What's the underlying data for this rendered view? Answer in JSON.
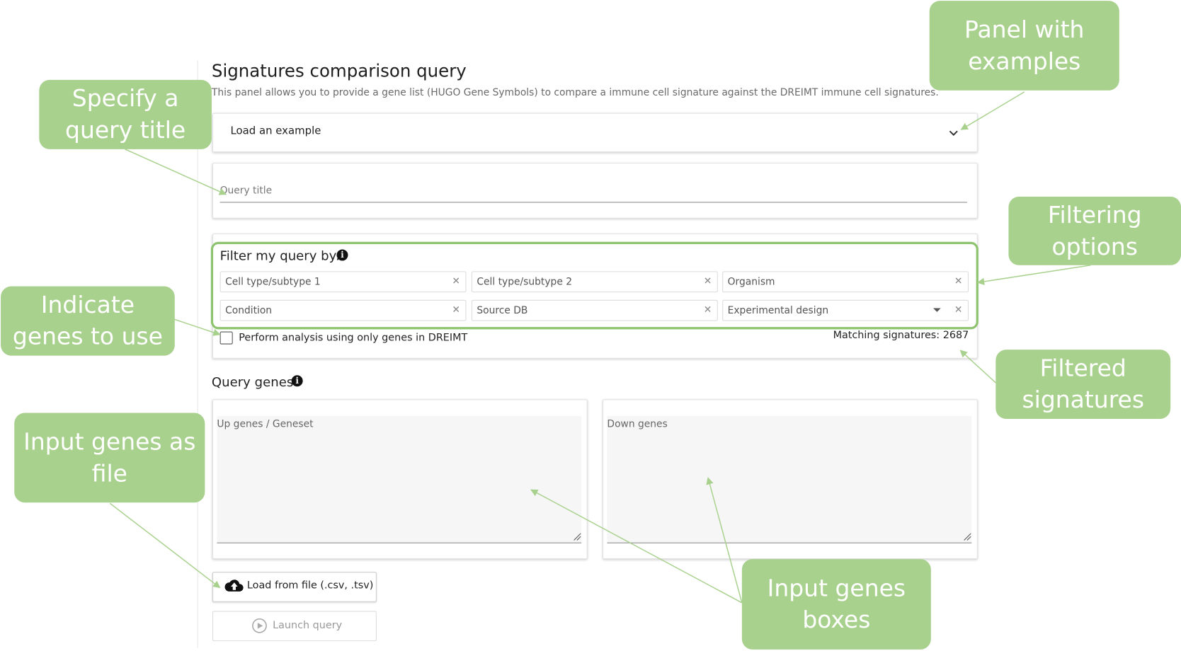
{
  "panel": {
    "title": "Signatures comparison query",
    "description": "This panel allows you to provide a gene list (HUGO Gene Symbols) to compare a immune cell signature against the DREIMT immune cell signatures."
  },
  "example": {
    "label": "Load an example"
  },
  "query_title": {
    "label": "Query title"
  },
  "filters": {
    "heading": "Filter my query by:",
    "fields": [
      "Cell type/subtype 1",
      "Cell type/subtype 2",
      "Organism",
      "Condition",
      "Source DB",
      "Experimental design"
    ],
    "checkbox_label": "Perform analysis using only genes in DREIMT",
    "matching_signatures": "Matching signatures: 2687"
  },
  "query_genes": {
    "heading": "Query genes",
    "up_label": "Up genes / Geneset",
    "down_label": "Down genes"
  },
  "buttons": {
    "load_file": "Load from file (.csv, .tsv)",
    "launch": "Launch query"
  },
  "callouts": {
    "panel_examples": [
      "Panel with",
      "examples"
    ],
    "query_title": [
      "Specify a",
      "query title"
    ],
    "filtering": [
      "Filtering",
      "options"
    ],
    "indicate_genes": [
      "Indicate",
      "genes to use"
    ],
    "filtered": [
      "Filtered",
      "signatures"
    ],
    "input_file": [
      "Input genes as",
      "file"
    ],
    "input_boxes": [
      "Input genes",
      "boxes"
    ]
  },
  "colors": {
    "callout": "#a9d18e",
    "highlight": "#8ec46f"
  }
}
